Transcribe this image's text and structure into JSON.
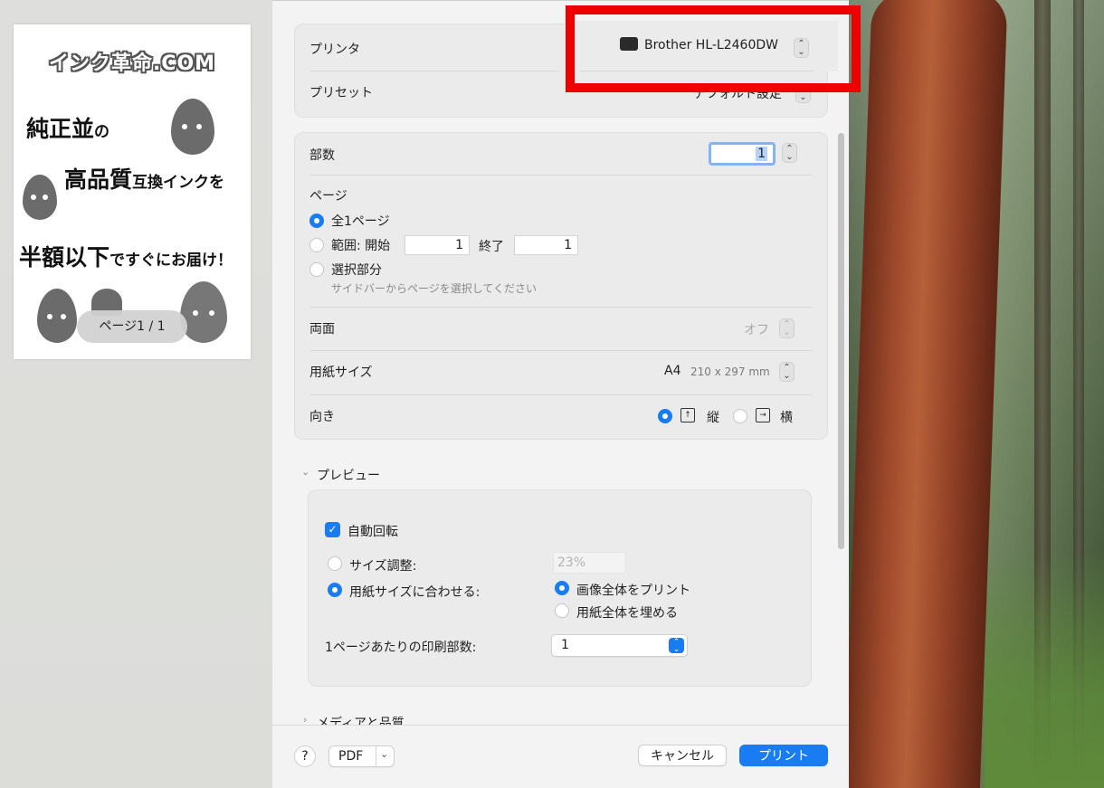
{
  "preview": {
    "logo": "インク革命.COM",
    "ad_line1_big": "純正並",
    "ad_line1_small": "の",
    "ad_line2_big": "高品質",
    "ad_line2_small": "互換インクを",
    "ad_line3_big": "半額以下",
    "ad_line3_small": "ですぐにお届け！",
    "page_badge": "ページ1 / 1"
  },
  "printer": {
    "label": "プリンタ",
    "value": "Brother HL-L2460DW",
    "icon": "printer-icon"
  },
  "preset": {
    "label": "プリセット",
    "value": "デフォルト設定"
  },
  "copies": {
    "label": "部数",
    "value": "1"
  },
  "pages": {
    "label": "ページ",
    "all_label": "全1ページ",
    "range_label": "範囲: 開始",
    "range_from": "1",
    "range_to_label": "終了",
    "range_to": "1",
    "selection_label": "選択部分",
    "selection_hint": "サイドバーからページを選択してください"
  },
  "duplex": {
    "label": "両面",
    "value": "オフ"
  },
  "paper_size": {
    "label": "用紙サイズ",
    "value": "A4",
    "dims": "210 x 297 mm"
  },
  "orientation": {
    "label": "向き",
    "portrait": "縦",
    "landscape": "横"
  },
  "preview_section": {
    "title": "プレビュー",
    "auto_rotate": "自動回転",
    "scale_label": "サイズ調整:",
    "scale_value": "23%",
    "fit_label": "用紙サイズに合わせる:",
    "print_entire": "画像全体をプリント",
    "fill_paper": "用紙全体を埋める",
    "copies_per_page_label": "1ページあたりの印刷部数:",
    "copies_per_page_value": "1"
  },
  "media_section": {
    "title": "メディアと品質"
  },
  "footer": {
    "help": "?",
    "pdf": "PDF",
    "cancel": "キャンセル",
    "print": "プリント"
  },
  "colors": {
    "accent": "#1a7cf3",
    "highlight_box": "#ee0000"
  }
}
